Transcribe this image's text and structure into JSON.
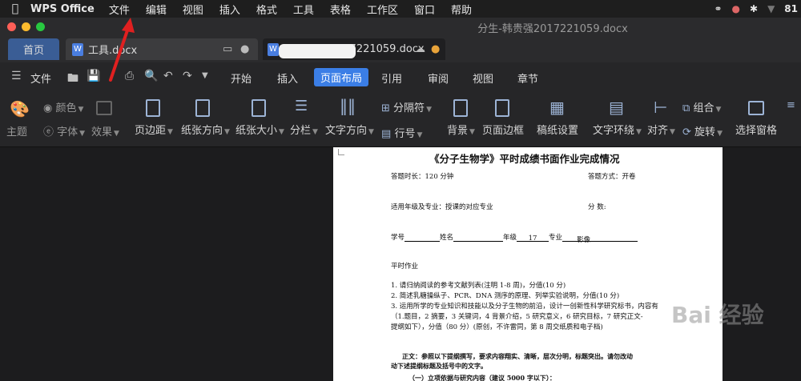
{
  "menubar": {
    "app_name": "WPS Office",
    "items": [
      "文件",
      "编辑",
      "视图",
      "插入",
      "格式",
      "工具",
      "表格",
      "工作区",
      "窗口",
      "帮助"
    ],
    "battery_text": "81"
  },
  "window": {
    "title": "分生-韩贵强2017221059.docx"
  },
  "tabs": {
    "home": "首页",
    "tab1": "工具.docx",
    "tab2": "017221059.docx"
  },
  "main_menu": {
    "file_label": "文件",
    "items": [
      "开始",
      "插入",
      "页面布局",
      "引用",
      "审阅",
      "视图",
      "章节"
    ]
  },
  "ribbon": {
    "theme": "主题",
    "color": "颜色",
    "font": "字体",
    "effect": "效果",
    "margins": "页边距",
    "orientation": "纸张方向",
    "size": "纸张大小",
    "columns": "分栏",
    "text_direction": "文字方向",
    "separator": "分隔符",
    "line_number": "行号",
    "background": "背景",
    "page_border": "页面边框",
    "grid_paper": "稿纸设置",
    "text_wrap": "文字环绕",
    "align": "对齐",
    "group": "组合",
    "rotate": "旋转",
    "selection_pane": "选择窗格"
  },
  "document": {
    "title": "《分子生物学》平时成绩书面作业完成情况",
    "duration": "答题时长：120   分钟",
    "method": "答题方式：开卷",
    "grade_major": "适用年级及专业：授课的对应专业",
    "score": "分        数:",
    "student_no": "学号",
    "name": "姓名",
    "grade": "年级",
    "grade_value": "17",
    "major": "专业",
    "major_value": "影像",
    "section": "平时作业",
    "items": [
      "1.   请归纳阅读的参考文献列表(注明 1-8 周)，分值(10 分)",
      "2.   简述乳糖操纵子、PCR、DNA 测序的原理、列举实验说明，分值(10 分)",
      "3.   运用所学的专业知识和技能以及分子生物的前沿，设计一创新性科学研究标书，内容有",
      "      （1.题目，2 摘要，3 关键词，4 背景介绍，5 研究意义，6 研究目标，7 研究正文-",
      "      提纲如下），分值（80 分）(原创，不许雷同，第 8 周交纸质和电子档)"
    ],
    "note1": "正文：参照以下提纲撰写，要求内容翔实、清晰，层次分明，标题突出。请勿改动",
    "note2": "动下述提纲标题及括号中的文字。",
    "sub_heading": "（一）立项依据与研究内容（建议 5000 字以下）："
  },
  "watermark": "Bai   经验",
  "colors": {
    "accent": "#3b7ee6",
    "arrow": "#e02020"
  }
}
